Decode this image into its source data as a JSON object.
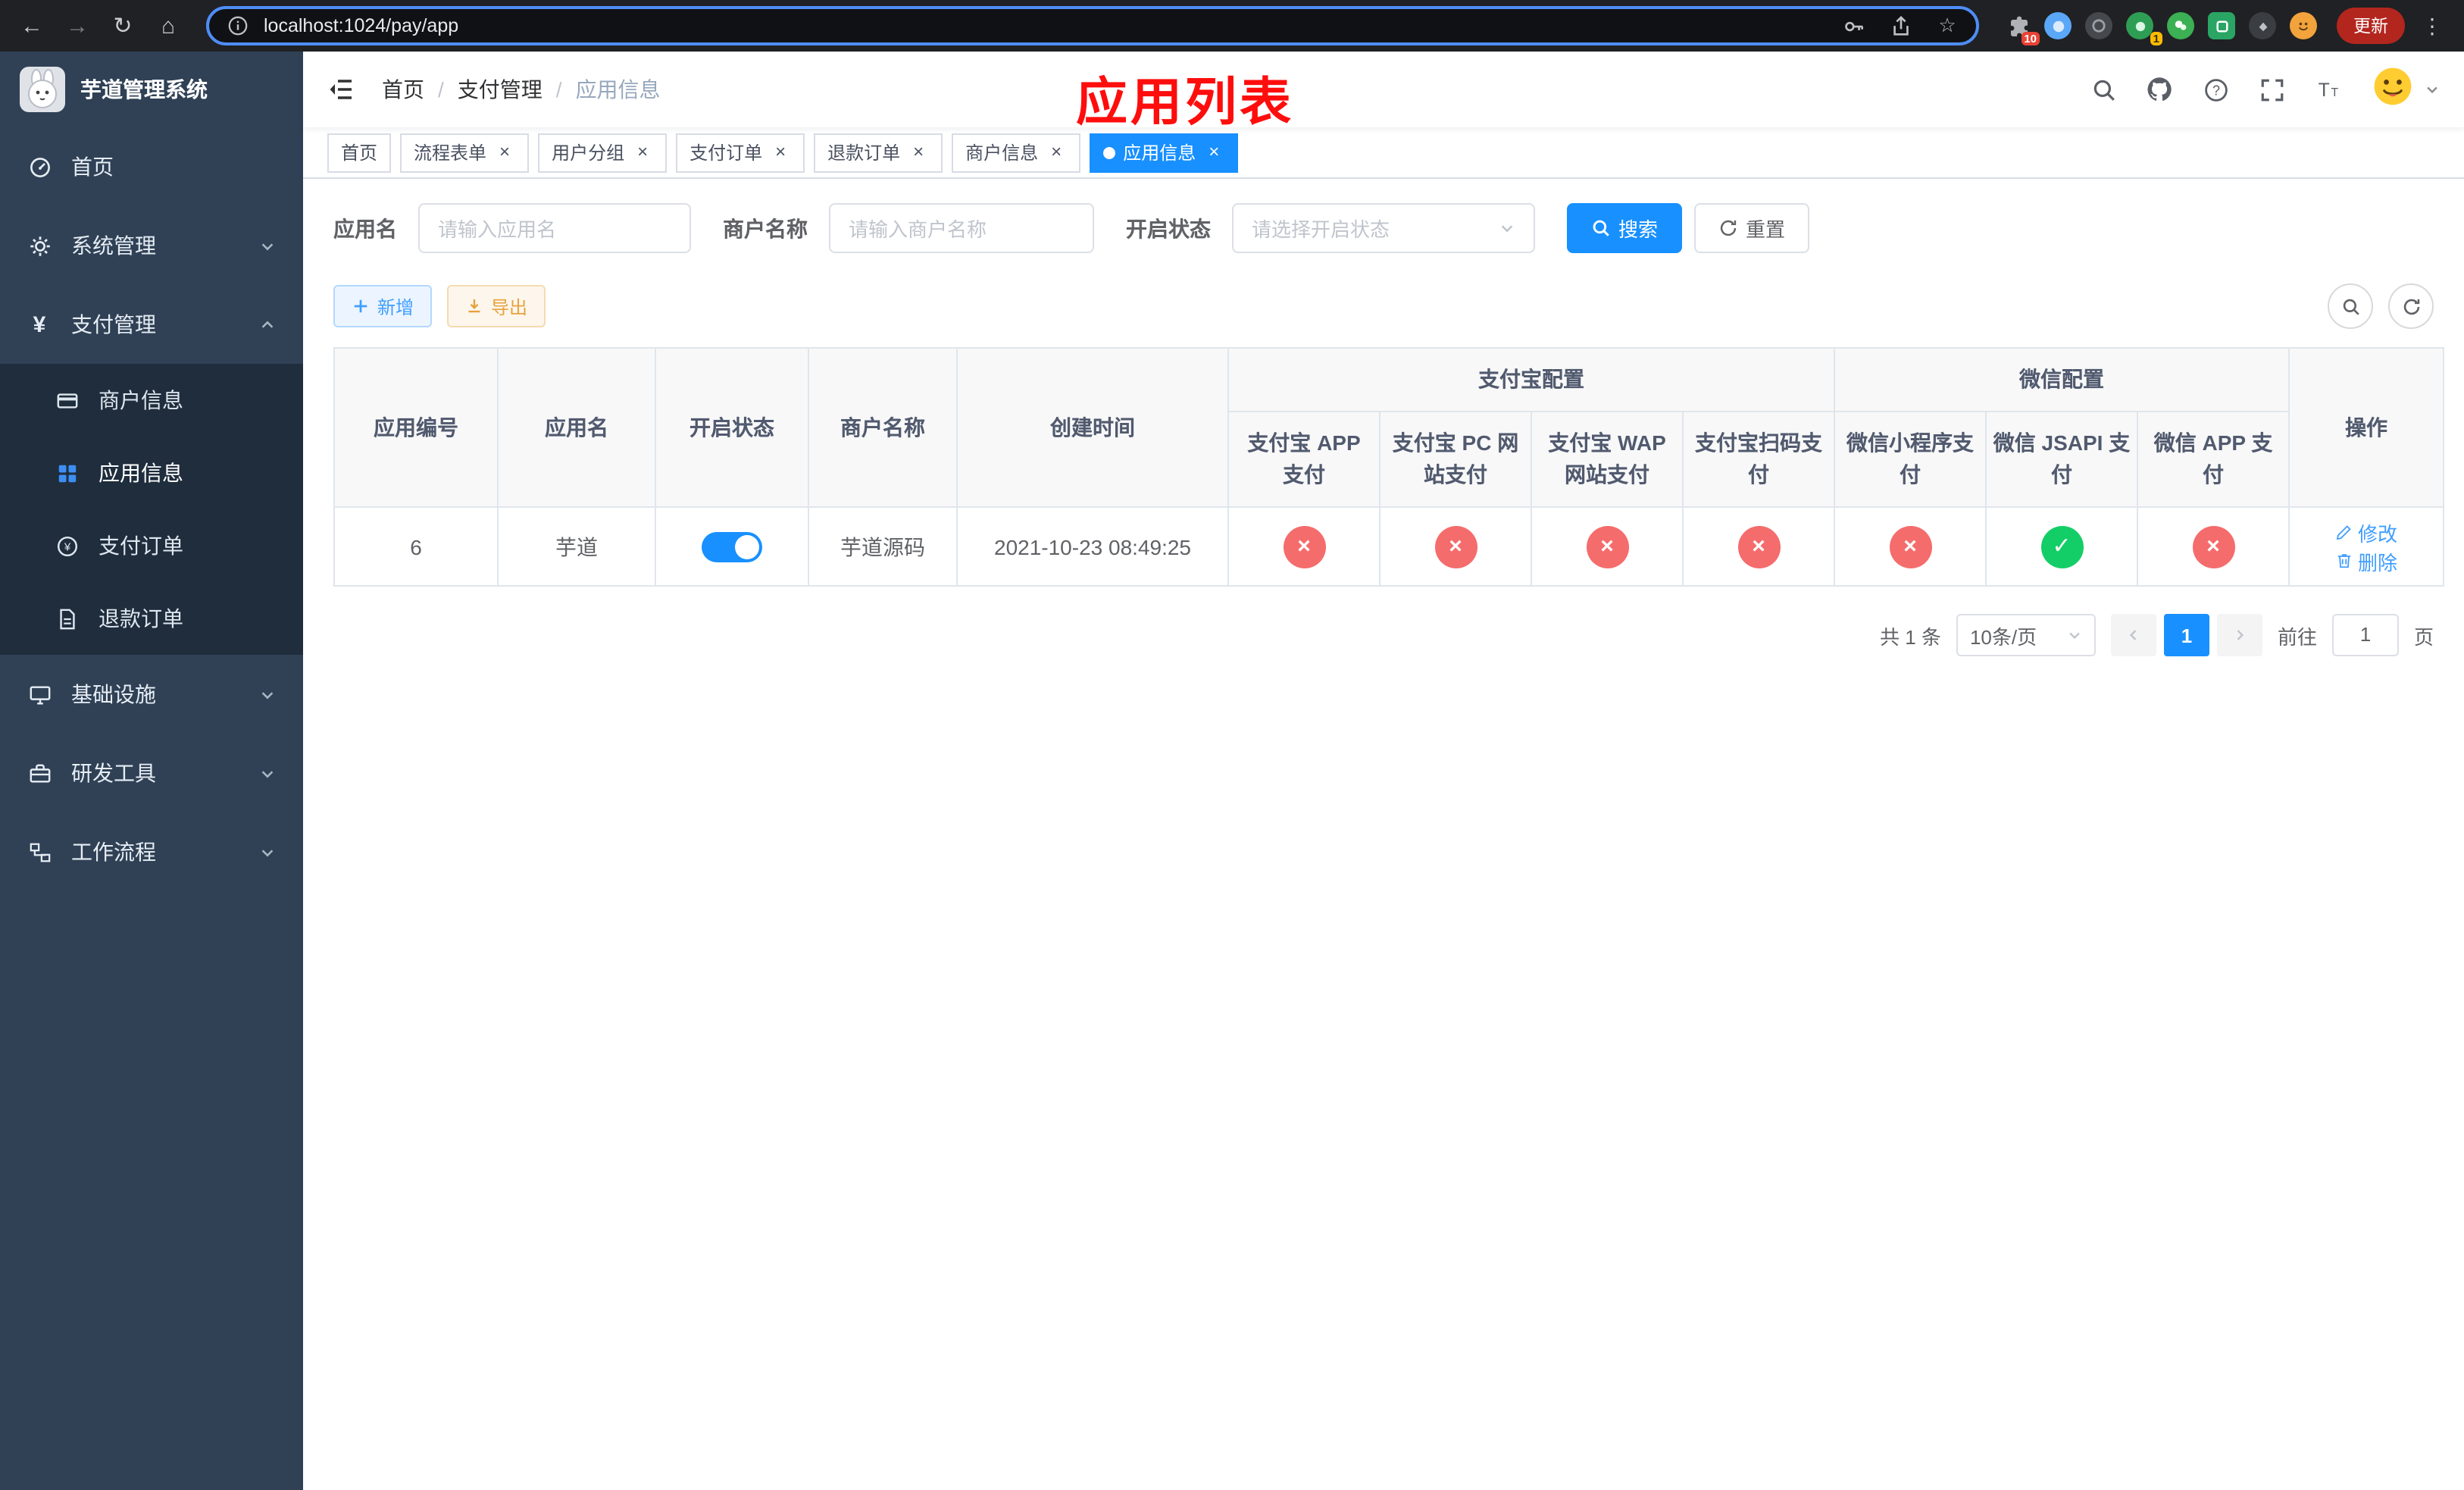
{
  "colors": {
    "accent": "#1890ff",
    "link": "#409eff",
    "success": "#13ce66",
    "danger": "#f56c6c",
    "sidebar": "#304156",
    "submenu": "#1f2d3d",
    "annotation": "#fe0d0d"
  },
  "glyphs": {
    "yes": "✓",
    "no": "×"
  },
  "browser": {
    "url": "localhost:1024/pay/app",
    "update_label": "更新",
    "puzzle_badge": "10",
    "green_badge": "1"
  },
  "annotation": {
    "title": "应用列表"
  },
  "sidebar": {
    "title": "芋道管理系统",
    "home": "首页",
    "system": "系统管理",
    "pay": "支付管理",
    "merchant": "商户信息",
    "app": "应用信息",
    "order": "支付订单",
    "refund": "退款订单",
    "infra": "基础设施",
    "devtool": "研发工具",
    "workflow": "工作流程"
  },
  "breadcrumb": {
    "items": [
      "首页",
      "支付管理",
      "应用信息"
    ]
  },
  "tabs": [
    {
      "label": "首页"
    },
    {
      "label": "流程表单"
    },
    {
      "label": "用户分组"
    },
    {
      "label": "支付订单"
    },
    {
      "label": "退款订单"
    },
    {
      "label": "商户信息"
    },
    {
      "label": "应用信息"
    }
  ],
  "filters": {
    "app_name_label": "应用名",
    "app_name_placeholder": "请输入应用名",
    "merchant_label": "商户名称",
    "merchant_placeholder": "请输入商户名称",
    "status_label": "开启状态",
    "status_placeholder": "请选择开启状态",
    "search": "搜索",
    "reset": "重置"
  },
  "toolbar": {
    "add": "新增",
    "export": "导出"
  },
  "table": {
    "headers": {
      "app_id": "应用编号",
      "app_name": "应用名",
      "status": "开启状态",
      "merchant": "商户名称",
      "created": "创建时间",
      "alipay_group": "支付宝配置",
      "wechat_group": "微信配置",
      "alipay_app": "支付宝 APP 支付",
      "alipay_pc": "支付宝 PC 网站支付",
      "alipay_wap": "支付宝 WAP 网站支付",
      "alipay_scan": "支付宝扫码支付",
      "wx_lite": "微信小程序支付",
      "wx_jsapi": "微信 JSAPI 支付",
      "wx_app": "微信 APP 支付",
      "actions": "操作"
    },
    "row": {
      "id": "6",
      "name": "芋道",
      "enabled": true,
      "merchant": "芋道源码",
      "created": "2021-10-23 08:49:25",
      "alipay_app": false,
      "alipay_pc": false,
      "alipay_wap": false,
      "alipay_scan": false,
      "wx_lite": false,
      "wx_jsapi": true,
      "wx_app": false,
      "edit": "修改",
      "delete": "删除"
    }
  },
  "pagination": {
    "total": "共 1 条",
    "page_size": "10条/页",
    "page": "1",
    "goto": "前往",
    "goto_value": "1",
    "unit": "页"
  }
}
